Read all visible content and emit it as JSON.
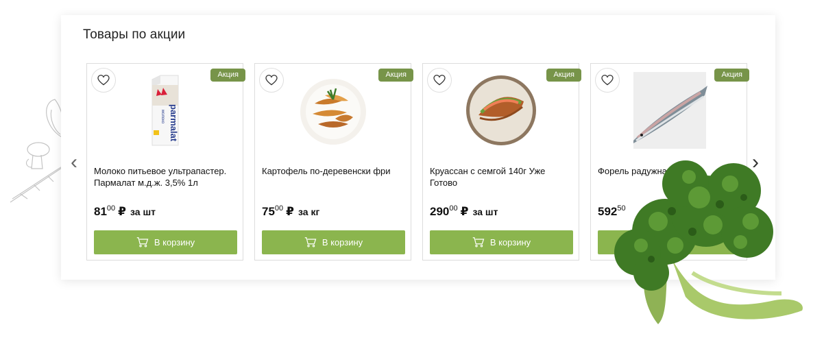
{
  "section": {
    "title": "Товары по акции",
    "badge": "Акция"
  },
  "products": [
    {
      "name": "Молоко питьевое ультрапастер. Пармалат м.д.ж. 3,5% 1л",
      "price_int": "81",
      "price_frac": "00",
      "currency": "₽",
      "unit": "за шт",
      "button": "В корзину",
      "image": "milk-carton-image",
      "brand_text": "parmalat",
      "sub_text": "молоко"
    },
    {
      "name": "Картофель по-деревенски фри",
      "price_int": "75",
      "price_frac": "00",
      "currency": "₽",
      "unit": "за кг",
      "button": "В корзину",
      "image": "potato-wedges-image"
    },
    {
      "name": "Круассан с семгой 140г Уже Готово",
      "price_int": "290",
      "price_frac": "00",
      "currency": "₽",
      "unit": "за шт",
      "button": "В корзину",
      "image": "salmon-croissant-image"
    },
    {
      "name": "Форель радужная \"Да Ма",
      "price_int": "592",
      "price_frac": "50",
      "currency": "",
      "unit": "",
      "button": "",
      "image": "trout-fish-image"
    }
  ],
  "nav": {
    "prev": "‹",
    "next": "›"
  },
  "colors": {
    "badge": "#779449",
    "button": "#8bb54e"
  }
}
